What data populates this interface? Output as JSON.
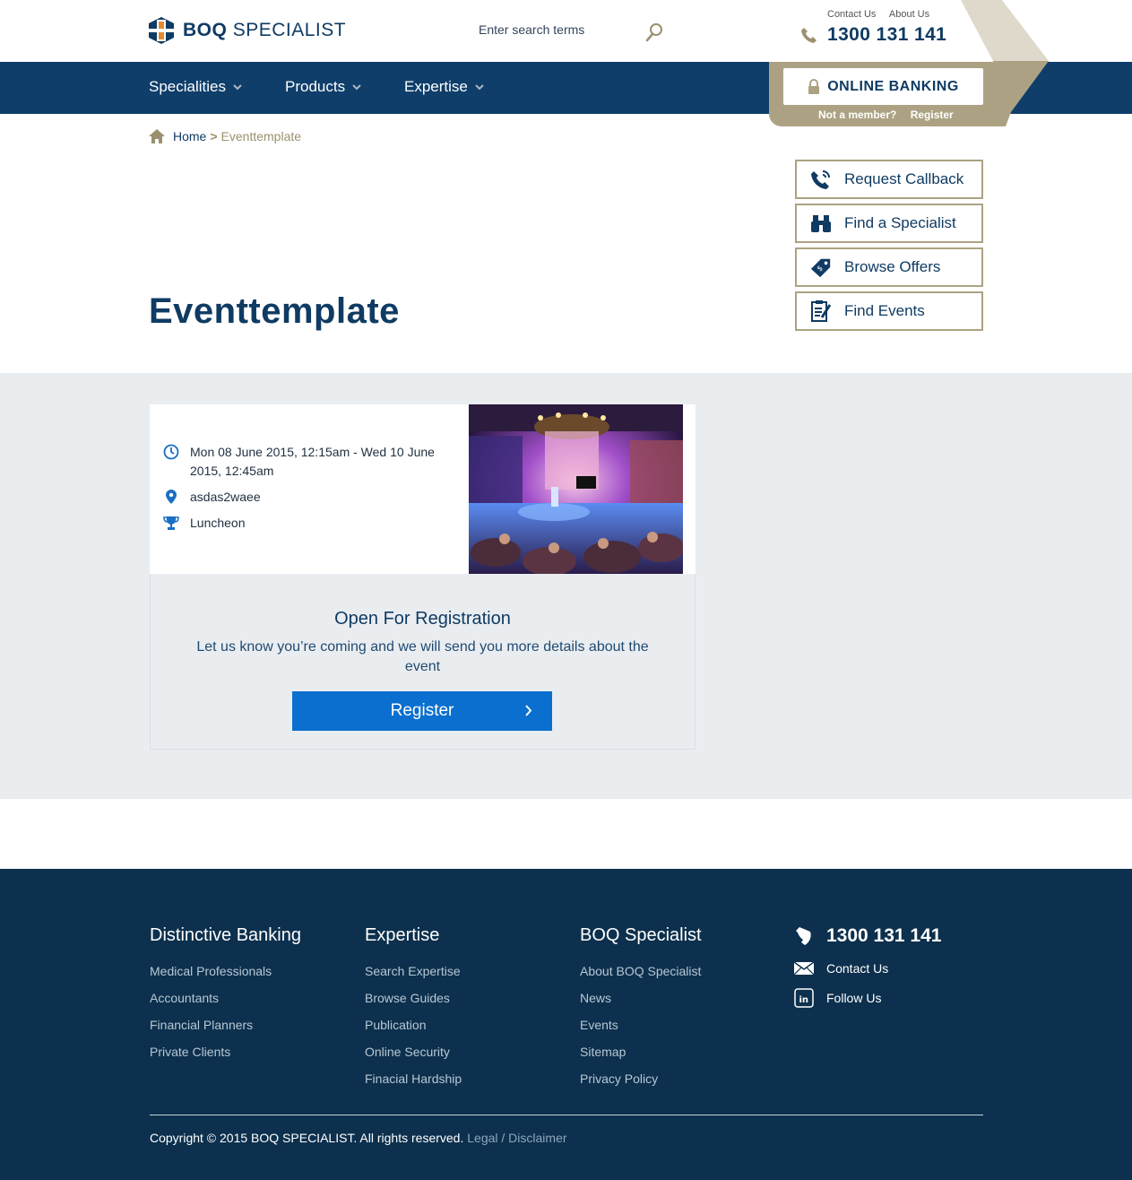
{
  "header": {
    "logo_bold": "BOQ",
    "logo_text": "SPECIALIST",
    "search_placeholder": "Enter search terms",
    "top_links": [
      "Contact Us",
      "About Us"
    ],
    "phone": "1300 131 141"
  },
  "nav": {
    "items": [
      "Specialities",
      "Products",
      "Expertise"
    ]
  },
  "online_banking": {
    "label": "ONLINE BANKING",
    "not_member": "Not a member?",
    "register": "Register"
  },
  "breadcrumb": {
    "home": "Home",
    "separator": ">",
    "current": "Eventtemplate"
  },
  "side_actions": [
    {
      "label": "Request Callback",
      "icon": "phone-callback-icon"
    },
    {
      "label": "Find a Specialist",
      "icon": "binoculars-icon"
    },
    {
      "label": "Browse Offers",
      "icon": "tag-icon"
    },
    {
      "label": "Find Events",
      "icon": "clipboard-icon"
    }
  ],
  "page": {
    "title": "Eventtemplate"
  },
  "event": {
    "datetime": "Mon 08 June 2015, 12:15am - Wed 10 June 2015, 12:45am",
    "location": "asdas2waee",
    "type": "Luncheon",
    "registration_title": "Open For Registration",
    "registration_text": "Let us know you’re coming and we will send you more details about the event",
    "register_label": "Register"
  },
  "footer": {
    "columns": [
      {
        "title": "Distinctive Banking",
        "links": [
          "Medical Professionals",
          "Accountants",
          "Financial Planners",
          "Private Clients"
        ]
      },
      {
        "title": "Expertise",
        "links": [
          "Search Expertise",
          "Browse Guides",
          "Publication",
          "Online Security",
          "Finacial Hardship"
        ]
      },
      {
        "title": "BOQ Specialist",
        "links": [
          "About BOQ Specialist",
          "News",
          "Events",
          "Sitemap",
          "Privacy Policy"
        ]
      }
    ],
    "phone": "1300 131 141",
    "contact": "Contact Us",
    "follow": "Follow Us",
    "copyright": "Copyright © 2015 BOQ SPECIALIST. All rights reserved.",
    "legal": "Legal / Disclaimer"
  },
  "colors": {
    "primary": "#0f3e6b",
    "accent": "#aca283",
    "button": "#0a6fce",
    "footer": "#0c304d",
    "band": "#eaedf0"
  }
}
